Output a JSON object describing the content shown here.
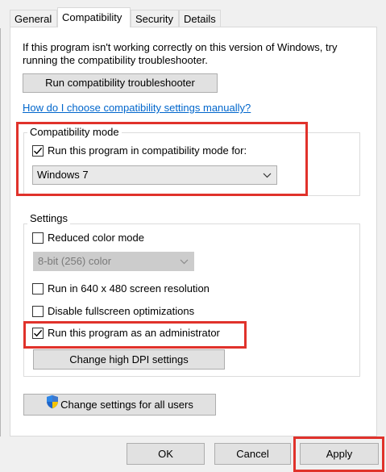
{
  "tabs": [
    {
      "label": "General"
    },
    {
      "label": "Compatibility"
    },
    {
      "label": "Security"
    },
    {
      "label": "Details"
    }
  ],
  "intro_text_line1": "If this program isn't working correctly on this version of Windows, try",
  "intro_text_line2": "running the compatibility troubleshooter.",
  "troubleshooter_button": "Run compatibility troubleshooter",
  "manual_link": "How do I choose compatibility settings manually?",
  "compat_mode": {
    "legend": "Compatibility mode",
    "checkbox_label": "Run this program in compatibility mode for:",
    "checked": true,
    "selected_os": "Windows 7"
  },
  "settings": {
    "legend": "Settings",
    "reduced_color": {
      "label": "Reduced color mode",
      "checked": false
    },
    "color_depth_value": "8-bit (256) color",
    "resolution_640": {
      "label": "Run in 640 x 480 screen resolution",
      "checked": false
    },
    "disable_fullscreen": {
      "label": "Disable fullscreen optimizations",
      "checked": false
    },
    "run_as_admin": {
      "label": "Run this program as an administrator",
      "checked": true
    },
    "high_dpi_button": "Change high DPI settings"
  },
  "all_users_button": "Change settings for all users",
  "footer": {
    "ok": "OK",
    "cancel": "Cancel",
    "apply": "Apply"
  },
  "colors": {
    "highlight_red": "#e0322b",
    "link_blue": "#0066cc",
    "focus_blue": "#0078d7"
  },
  "icons": {
    "shield": "uac-shield-icon",
    "chevron": "chevron-down-icon",
    "check": "check-icon"
  }
}
